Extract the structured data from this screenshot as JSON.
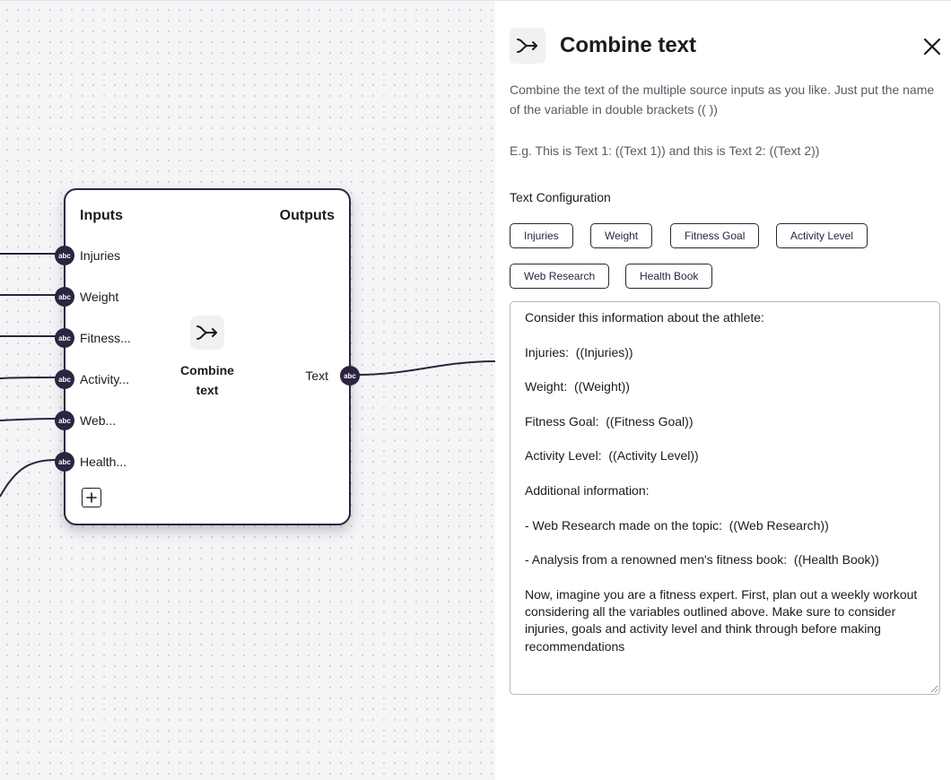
{
  "node": {
    "inputs_heading": "Inputs",
    "outputs_heading": "Outputs",
    "title_line1": "Combine",
    "title_line2": "text",
    "port_badge": "abc",
    "inputs": [
      {
        "label": "Injuries"
      },
      {
        "label": "Weight"
      },
      {
        "label": "Fitness..."
      },
      {
        "label": "Activity..."
      },
      {
        "label": "Web..."
      },
      {
        "label": "Health..."
      }
    ],
    "output": {
      "label": "Text"
    },
    "icon": "merge-arrow-icon",
    "add_icon": "plus-icon"
  },
  "panel": {
    "title": "Combine text",
    "icon": "merge-arrow-icon",
    "close_icon": "close-icon",
    "description": "Combine the text of the multiple source inputs as you like. Just put the name of the variable in double brackets (( ))",
    "example": "E.g. This is Text 1: ((Text 1)) and this is Text 2: ((Text 2))",
    "section_label": "Text Configuration",
    "variable_chips": [
      "Injuries",
      "Weight",
      "Fitness Goal",
      "Activity Level",
      "Web Research",
      "Health Book"
    ],
    "template_text": "Consider this information about the athlete:\n\nInjuries:  ((Injuries))\n\nWeight:  ((Weight))\n\nFitness Goal:  ((Fitness Goal))\n\nActivity Level:  ((Activity Level))\n\nAdditional information:\n\n- Web Research made on the topic:  ((Web Research))\n\n- Analysis from a renowned men's fitness book:  ((Health Book))\n\nNow, imagine you are a fitness expert. First, plan out a weekly workout considering all the variables outlined above. Make sure to consider injuries, goals and activity level and think through before making recommendations"
  },
  "colors": {
    "accent": "#2c2440",
    "canvas_bg": "#f5f5f7",
    "dot": "#cfd0d6"
  }
}
